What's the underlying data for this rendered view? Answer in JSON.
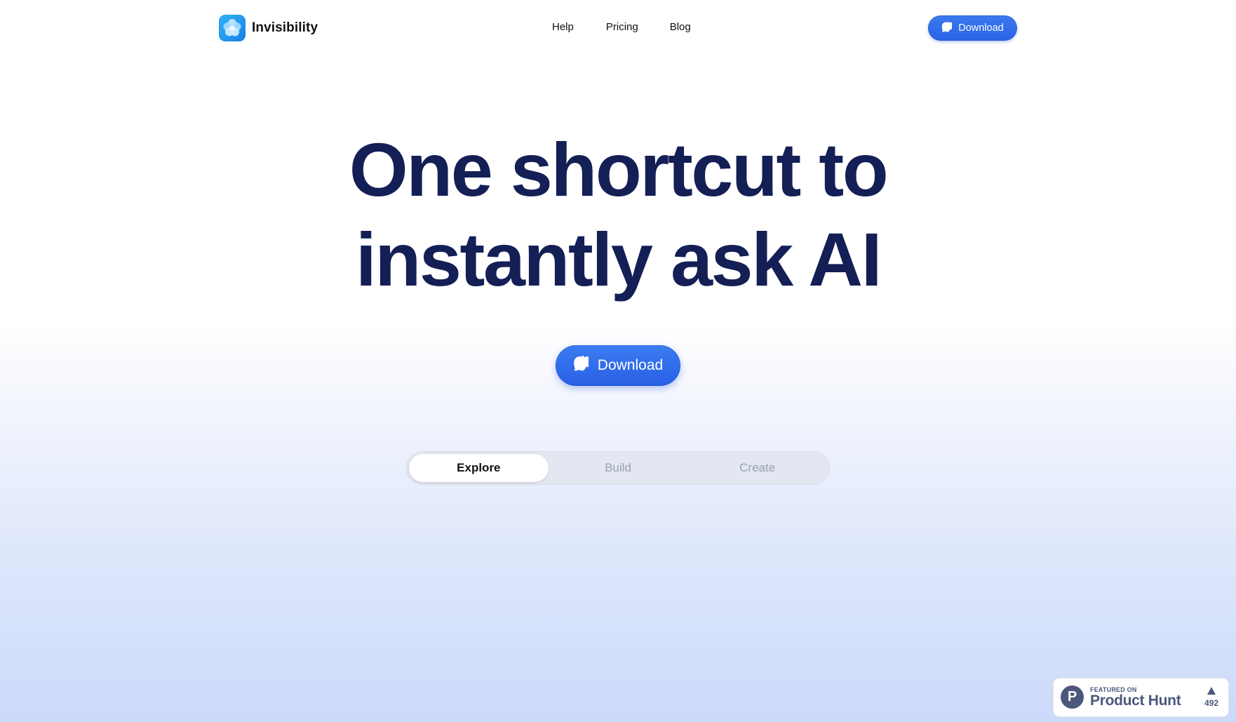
{
  "header": {
    "brand_name": "Invisibility",
    "nav": [
      {
        "label": "Help"
      },
      {
        "label": "Pricing"
      },
      {
        "label": "Blog"
      }
    ],
    "download_label": "Download"
  },
  "hero": {
    "title_line1": "One shortcut to",
    "title_line2": "instantly ask AI",
    "download_label": "Download"
  },
  "tabs": [
    {
      "label": "Explore",
      "active": true
    },
    {
      "label": "Build",
      "active": false
    },
    {
      "label": "Create",
      "active": false
    }
  ],
  "product_hunt": {
    "featured": "FEATURED ON",
    "name": "Product Hunt",
    "count": "492",
    "logo_letter": "P"
  },
  "colors": {
    "brand_blue": "#2a63e4",
    "title_navy": "#141f56",
    "ph_slate": "#4b587c"
  },
  "icons": [
    "invisibility-logo-icon",
    "apple-icon",
    "product-hunt-logo-icon",
    "upvote-arrow-icon"
  ]
}
